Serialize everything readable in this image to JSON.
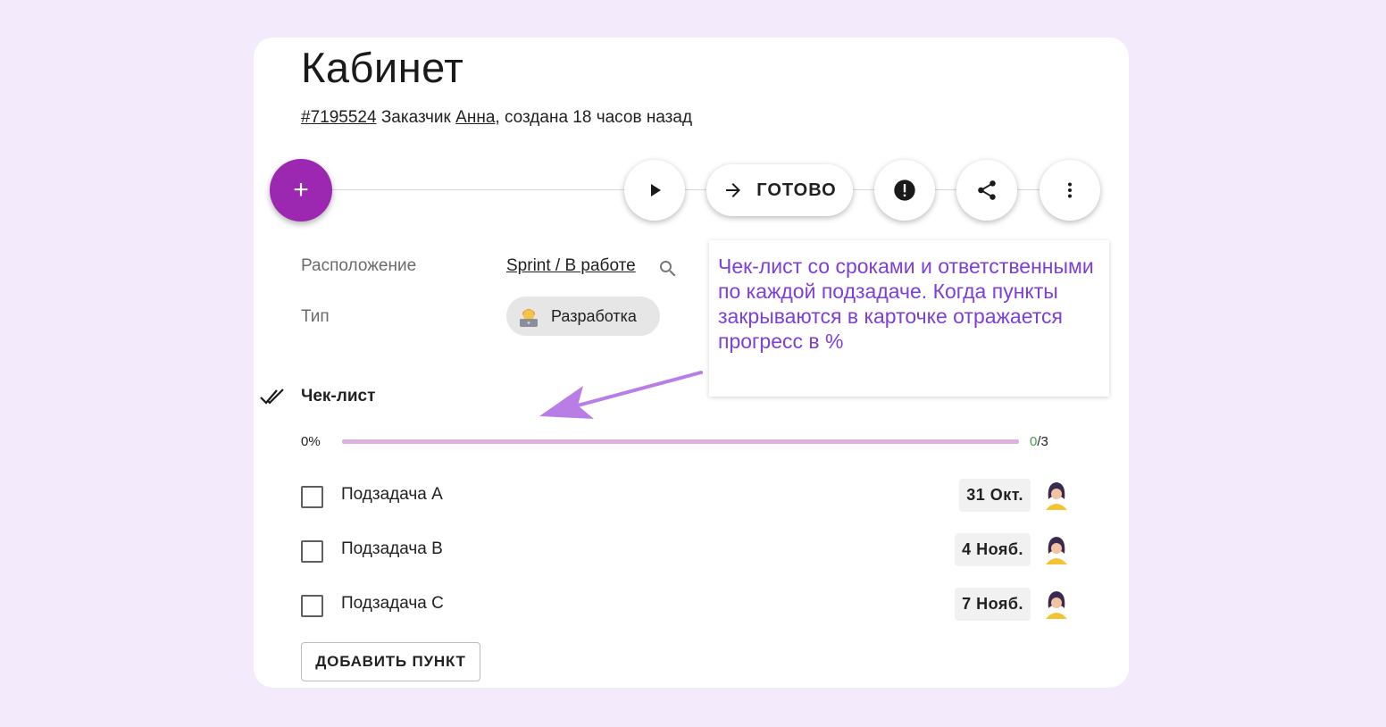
{
  "task": {
    "title": "Кабинет",
    "id": "#7195524",
    "customer_label": "Заказчик",
    "customer_name": "Анна",
    "created": ", создана 18 часов назад"
  },
  "toolbar": {
    "add_label": "+",
    "done_label": "ГОТОВО"
  },
  "fields": {
    "location_label": "Расположение",
    "location_value": "Sprint / В работе",
    "type_label": "Тип",
    "type_value": "Разработка"
  },
  "annotation": {
    "text": "Чек-лист со сроками и ответственными по каждой подзадаче. Когда пункты закрываются в карточке отражается прогресс в %",
    "color": "#7e3fd6"
  },
  "checklist": {
    "title": "Чек-лист",
    "progress_label": "0%",
    "progress_fraction": 0,
    "done_count": "0",
    "total_count": "/3",
    "items": [
      {
        "label": "Подзадача A",
        "date": "31 Окт."
      },
      {
        "label": "Подзадача B",
        "date": "4 Нояб."
      },
      {
        "label": "Подзадача C",
        "date": "7 Нояб."
      }
    ],
    "add_button": "ДОБАВИТЬ ПУНКТ"
  },
  "colors": {
    "accent": "#9c27b0",
    "background": "#f3eafc",
    "progress_track": "#dcb1e2",
    "done_count": "#43a047"
  }
}
